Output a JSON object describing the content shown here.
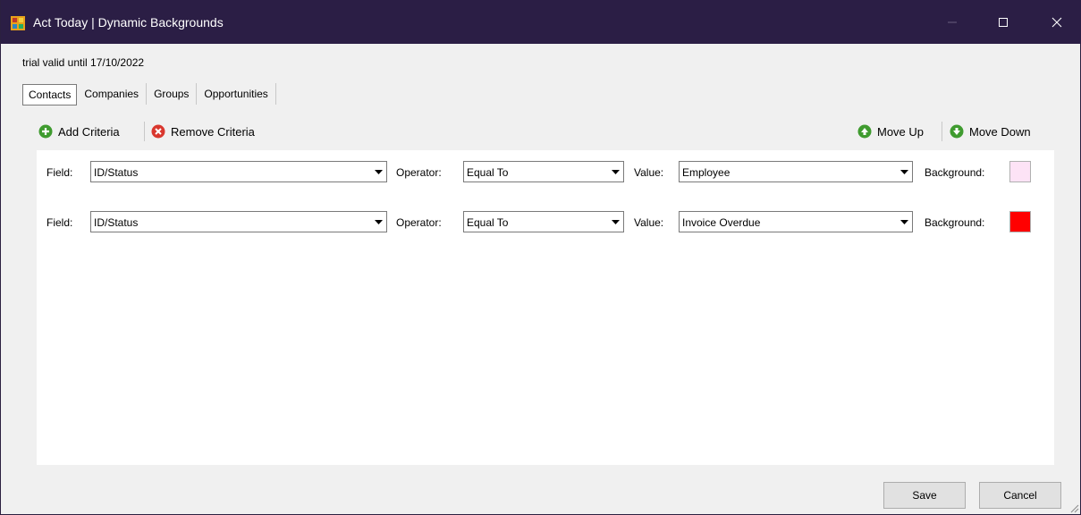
{
  "window": {
    "title": "Act Today | Dynamic Backgrounds"
  },
  "trial_text": "trial valid until 17/10/2022",
  "tabs": [
    {
      "label": "Contacts",
      "active": true
    },
    {
      "label": "Companies",
      "active": false
    },
    {
      "label": "Groups",
      "active": false
    },
    {
      "label": "Opportunities",
      "active": false
    }
  ],
  "toolbar": {
    "add_label": "Add Criteria",
    "remove_label": "Remove Criteria",
    "move_up_label": "Move Up",
    "move_down_label": "Move Down"
  },
  "labels": {
    "field": "Field:",
    "operator": "Operator:",
    "value": "Value:",
    "background": "Background:"
  },
  "criteria": [
    {
      "field": "ID/Status",
      "operator": "Equal To",
      "value": "Employee",
      "background": "#fde3f6"
    },
    {
      "field": "ID/Status",
      "operator": "Equal To",
      "value": "Invoice Overdue",
      "background": "#ff0000"
    }
  ],
  "buttons": {
    "save": "Save",
    "cancel": "Cancel"
  },
  "colors": {
    "titlebar": "#2b1e45",
    "add_icon": "#3f9b2f",
    "remove_icon": "#d9372e"
  }
}
